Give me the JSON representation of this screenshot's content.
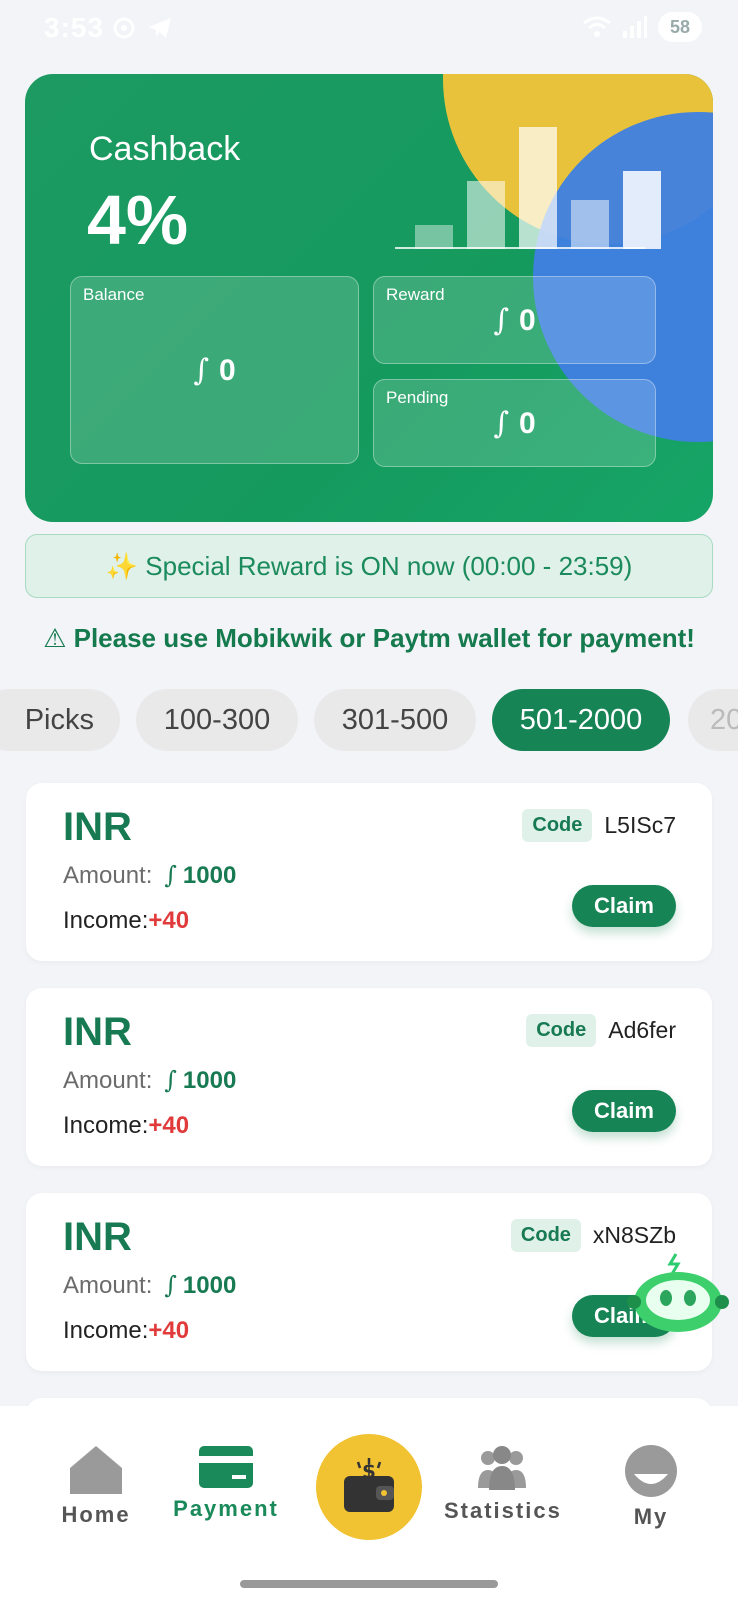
{
  "status_bar": {
    "time": "3:53",
    "battery": "58"
  },
  "cashback": {
    "title": "Cashback",
    "rate": "4%",
    "currency_symbol": "∫",
    "balance": {
      "label": "Balance",
      "value": "0"
    },
    "reward": {
      "label": "Reward",
      "value": "0"
    },
    "pending": {
      "label": "Pending",
      "value": "0"
    },
    "chart_bars": [
      0.2,
      0.56,
      1.0,
      0.4,
      0.64
    ]
  },
  "reward_banner": "✨ Special Reward is ON now (00:00 - 23:59)",
  "notice": "⚠ Please use Mobikwik or Paytm wallet for payment!",
  "filters": [
    {
      "label": "Picks",
      "active": false
    },
    {
      "label": "100-300",
      "active": false
    },
    {
      "label": "301-500",
      "active": false
    },
    {
      "label": "501-2000",
      "active": true
    },
    {
      "label": "20",
      "active": false
    }
  ],
  "offers": [
    {
      "currency": "INR",
      "amount_label": "Amount:",
      "amount": "1000",
      "income_label": "Income:",
      "income": "+40",
      "code_label": "Code",
      "code": "L5ISc7",
      "claim": "Claim"
    },
    {
      "currency": "INR",
      "amount_label": "Amount:",
      "amount": "1000",
      "income_label": "Income:",
      "income": "+40",
      "code_label": "Code",
      "code": "Ad6fer",
      "claim": "Claim"
    },
    {
      "currency": "INR",
      "amount_label": "Amount:",
      "amount": "1000",
      "income_label": "Income:",
      "income": "+40",
      "code_label": "Code",
      "code": "xN8SZb",
      "claim": "Claim"
    }
  ],
  "nav": {
    "home": "Home",
    "payment": "Payment",
    "statistics": "Statistics",
    "my": "My"
  },
  "colors": {
    "primary": "#168455",
    "accent_yellow": "#f1c232",
    "accent_blue": "#3f7fe3",
    "income_red": "#e03a3a"
  }
}
